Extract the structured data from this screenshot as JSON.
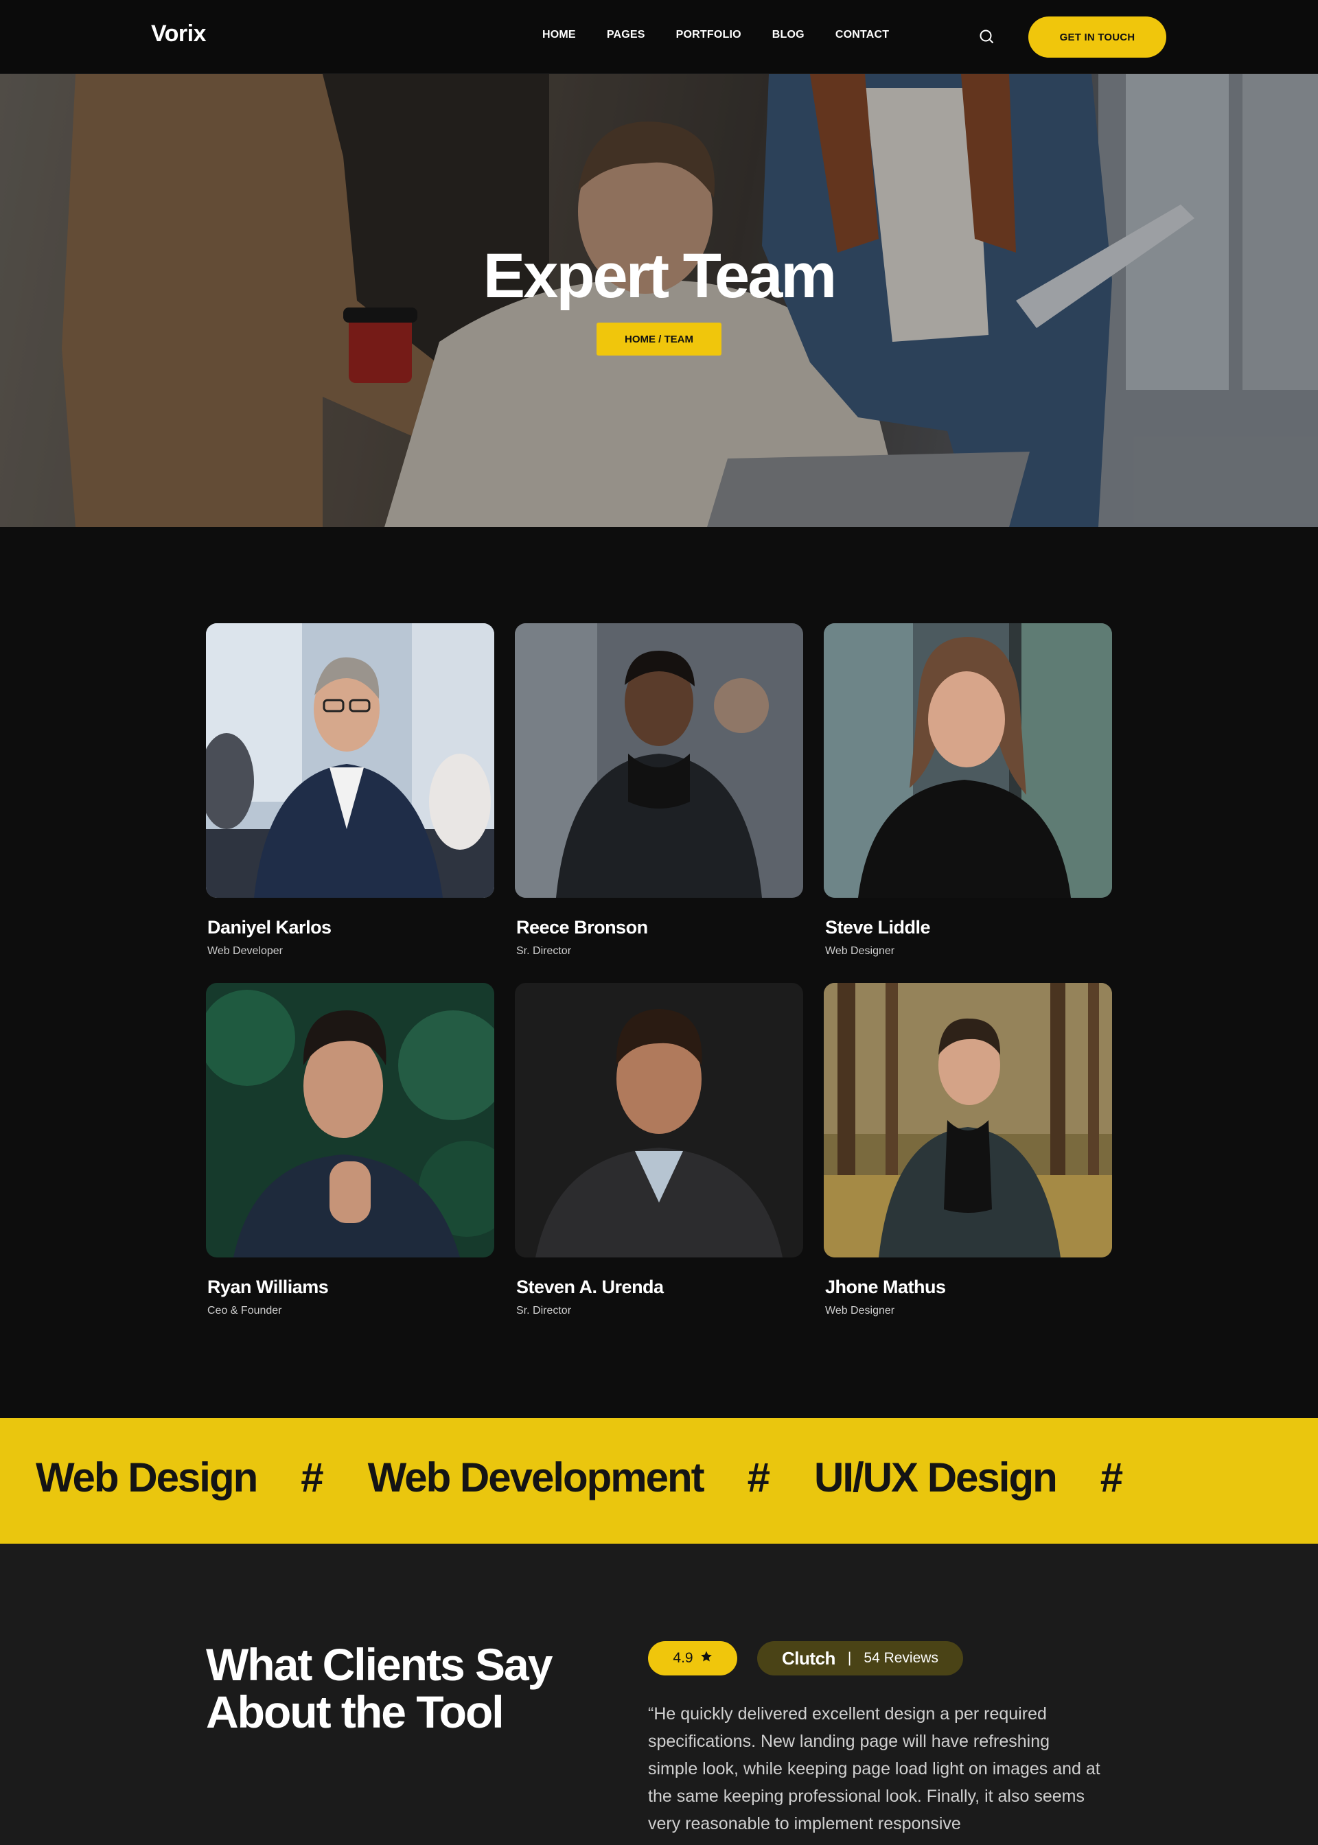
{
  "header": {
    "logo": "Vorix",
    "nav": [
      "HOME",
      "PAGES",
      "PORTFOLIO",
      "BLOG",
      "CONTACT"
    ],
    "search_icon": "search-icon",
    "cta_label": "GET IN TOUCH"
  },
  "hero": {
    "title": "Expert Team",
    "breadcrumb": "HOME / TEAM"
  },
  "team": {
    "members": [
      {
        "name": "Daniyel Karlos",
        "role": "Web Developer"
      },
      {
        "name": "Reece Bronson",
        "role": "Sr. Director"
      },
      {
        "name": "Steve Liddle",
        "role": "Web Designer"
      },
      {
        "name": "Ryan Williams",
        "role": "Ceo & Founder"
      },
      {
        "name": "Steven A. Urenda",
        "role": "Sr. Director"
      },
      {
        "name": "Jhone Mathus",
        "role": "Web Designer"
      }
    ]
  },
  "band": {
    "items": [
      "Web Design",
      "Web Development",
      "UI/UX Design"
    ],
    "separator": "#"
  },
  "testimonials": {
    "title": "What Clients Say About the Tool",
    "rating": "4.9",
    "clutch_name": "Clutch",
    "clutch_sep": "|",
    "reviews": "54 Reviews",
    "quote": "“He quickly delivered excellent design a per required specifications. New landing page will have refreshing simple look, while keeping page load light on images and at the same keeping professional look. Finally, it also seems very reasonable to implement responsive"
  },
  "colors": {
    "accent": "#f0c60c",
    "background": "#0d0d0d",
    "testimonial_bg": "#1b1b1b",
    "clutch_badge": "#4a4316"
  }
}
